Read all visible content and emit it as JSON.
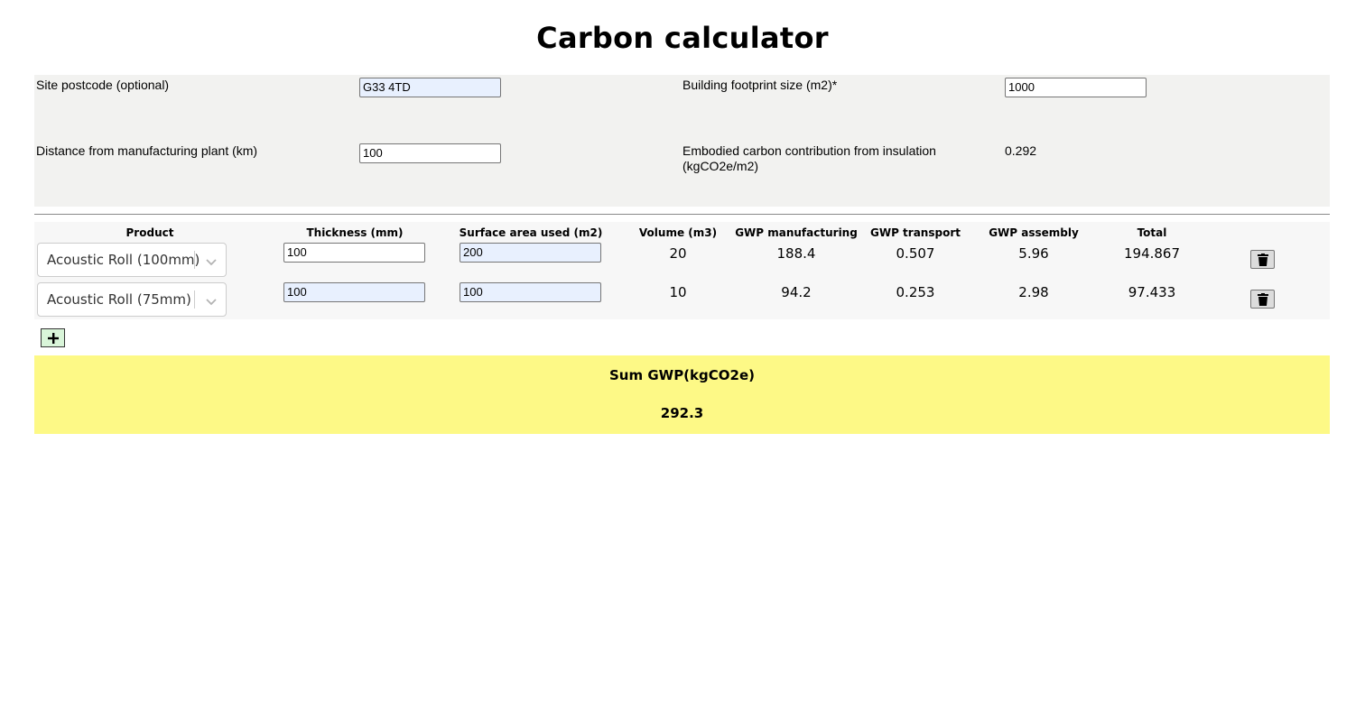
{
  "page": {
    "title": "Carbon calculator"
  },
  "settings": {
    "postcode_label": "Site postcode (optional)",
    "postcode_value": "G33 4TD",
    "footprint_label": "Building footprint size (m2)*",
    "footprint_value": "1000",
    "distance_label": "Distance from manufacturing plant (km)",
    "distance_value": "100",
    "embodied_label_line1": "Embodied carbon contribution from insulation",
    "embodied_label_line2": "(kgCO2e/m2)",
    "embodied_value": "0.292"
  },
  "table": {
    "headers": {
      "product": "Product",
      "thickness": "Thickness (mm)",
      "surface_area": "Surface area used (m2)",
      "volume": "Volume (m3)",
      "gwp_manufacturing": "GWP manufacturing",
      "gwp_transport": "GWP transport",
      "gwp_assembly": "GWP assembly",
      "total": "Total"
    },
    "rows": [
      {
        "product": "Acoustic Roll (100mm)",
        "thickness": "100",
        "surface_area": "200",
        "volume": "20",
        "gwp_manufacturing": "188.4",
        "gwp_transport": "0.507",
        "gwp_assembly": "5.96",
        "total": "194.867"
      },
      {
        "product": "Acoustic Roll (75mm)",
        "thickness": "100",
        "surface_area": "100",
        "volume": "10",
        "gwp_manufacturing": "94.2",
        "gwp_transport": "0.253",
        "gwp_assembly": "2.98",
        "total": "97.433"
      }
    ]
  },
  "summary": {
    "title": "Sum GWP(kgCO2e)",
    "value": "292.3"
  },
  "icons": {
    "delete": "trash-icon",
    "add": "plus-icon",
    "dropdown": "chevron-down-icon"
  },
  "colors": {
    "settings_bg": "#f2f2f0",
    "table_bg": "#f7f7f7",
    "summary_bg": "#fdf986",
    "add_button_bg": "#d9f5d9",
    "autofill_bg": "#e8f0fe"
  }
}
